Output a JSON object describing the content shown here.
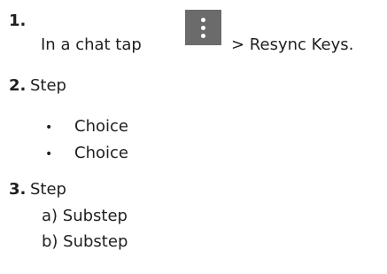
{
  "steps": [
    {
      "number": "1.",
      "text_before": "In a chat tap",
      "text_after": "> Resync Keys.",
      "icon": "more-vertical-icon"
    },
    {
      "number": "2.",
      "text": "Step",
      "choices": [
        "Choice",
        "Choice"
      ]
    },
    {
      "number": "3.",
      "text": "Step",
      "substeps": [
        "a) Substep",
        "b) Substep"
      ]
    }
  ],
  "colors": {
    "text": "#1f1f1f",
    "icon_background": "#6b6b6b",
    "icon_dots": "#ffffff"
  }
}
